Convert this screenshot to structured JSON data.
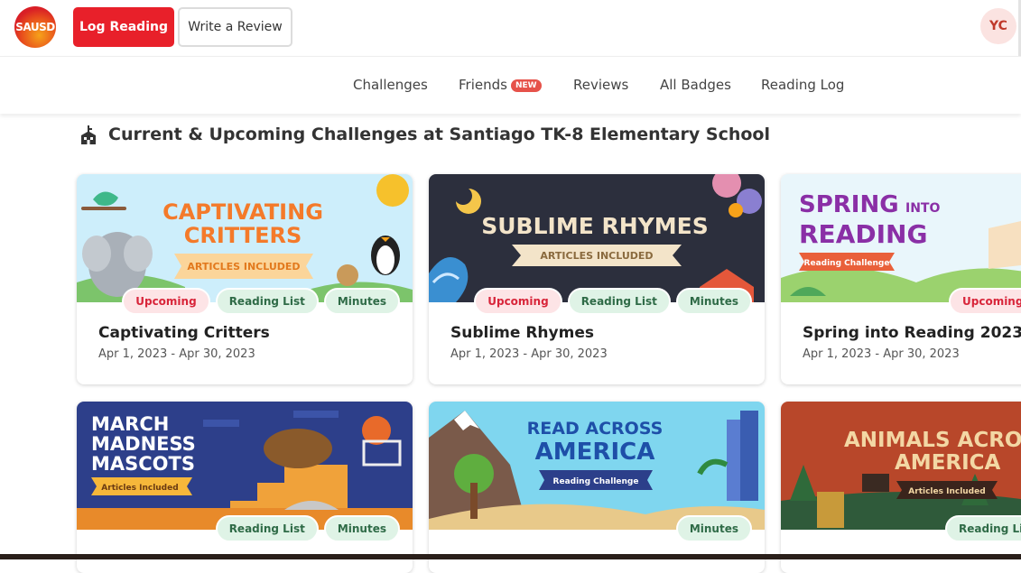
{
  "header": {
    "logo_text": "SAUSD",
    "log_reading_label": "Log Reading",
    "write_review_label": "Write a Review",
    "avatar_initials": "YC"
  },
  "nav": {
    "items": [
      {
        "label": "Challenges"
      },
      {
        "label": "Friends",
        "badge": "NEW"
      },
      {
        "label": "Reviews"
      },
      {
        "label": "All Badges"
      },
      {
        "label": "Reading Log"
      }
    ]
  },
  "section": {
    "title": "Current & Upcoming Challenges at Santiago TK-8 Elementary School"
  },
  "cards": [
    {
      "title": "Captivating Critters",
      "date": "Apr 1, 2023 - Apr 30, 2023",
      "art_line1": "CAPTIVATING",
      "art_line2": "CRITTERS",
      "art_sub": "ARTICLES INCLUDED",
      "tags": [
        "Upcoming",
        "Reading List",
        "Minutes"
      ]
    },
    {
      "title": "Sublime Rhymes",
      "date": "Apr 1, 2023 - Apr 30, 2023",
      "art_line1": "SUBLIME RHYMES",
      "art_sub": "ARTICLES INCLUDED",
      "tags": [
        "Upcoming",
        "Reading List",
        "Minutes"
      ]
    },
    {
      "title": "Spring into Reading 2023",
      "date": "Apr 1, 2023 - Apr 30, 2023",
      "art_line1": "SPRING",
      "art_line1b": "INTO",
      "art_line2": "READING",
      "art_sub": "Reading Challenge",
      "tags": [
        "Upcoming"
      ]
    },
    {
      "art_line1": "MARCH",
      "art_line2": "MADNESS",
      "art_line3": "MASCOTS",
      "art_sub": "Articles Included",
      "tags": [
        "Reading List",
        "Minutes"
      ]
    },
    {
      "art_line1": "READ ACROSS",
      "art_line2": "AMERICA",
      "art_sub": "Reading Challenge",
      "tags": [
        "Minutes"
      ]
    },
    {
      "art_line1": "ANIMALS ACRO",
      "art_line2": "AMERICA",
      "art_sub": "Articles Included",
      "tags": [
        "Reading List"
      ]
    }
  ],
  "colors": {
    "brand_red": "#e8202a",
    "upcoming_bg": "#fde4e6",
    "reading_list_bg": "#dff3e6"
  }
}
